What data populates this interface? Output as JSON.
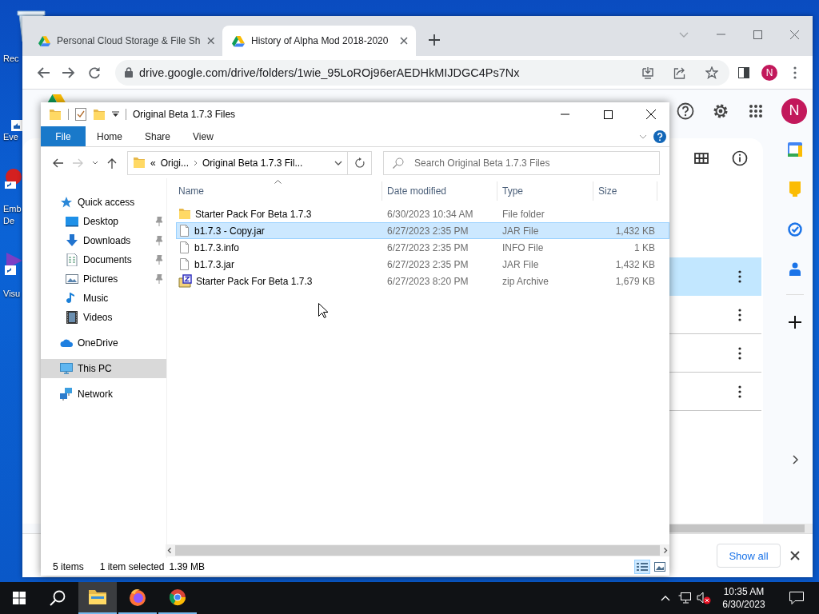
{
  "desktop": {
    "icons": [
      {
        "kind": "bin",
        "lines": [
          "Rec"
        ]
      },
      {
        "kind": "shortcut",
        "lines": [
          "Eve"
        ]
      },
      {
        "kind": "red-app",
        "lines": [
          "Emb",
          "De"
        ]
      },
      {
        "kind": "purple-app",
        "lines": [
          "Visu"
        ]
      }
    ]
  },
  "browser": {
    "tabs": [
      {
        "title": "Personal Cloud Storage & File Sh",
        "selected": false
      },
      {
        "title": "History of Alpha Mod 2018-2020",
        "selected": true
      }
    ],
    "url": "drive.google.com/drive/folders/1wie_95LoROj96erAEDHkMIJDGC4Ps7Nx",
    "profile_initial": "N",
    "drive": {
      "account_initial": "N",
      "rows": [
        {
          "selected": true
        },
        {
          "selected": false
        },
        {
          "selected": false
        },
        {
          "selected": false
        }
      ]
    },
    "downloads_bar": {
      "button": "Show all"
    }
  },
  "explorer": {
    "title": "Original Beta 1.7.3 Files",
    "ribbon": [
      {
        "label": "File",
        "kind": "file-menu"
      },
      {
        "label": "Home",
        "kind": "tab"
      },
      {
        "label": "Share",
        "kind": "tab"
      },
      {
        "label": "View",
        "kind": "tab"
      }
    ],
    "address": {
      "overflow": "«",
      "parts": [
        "Origi...",
        "Original Beta 1.7.3 Fil..."
      ]
    },
    "search": {
      "placeholder": "Search Original Beta 1.7.3 Files"
    },
    "nav": [
      {
        "label": "Quick access",
        "kind": "star",
        "selected": false,
        "children": [
          {
            "label": "Desktop",
            "kind": "desktop",
            "pinned": true,
            "selected": false
          },
          {
            "label": "Downloads",
            "kind": "downloads",
            "pinned": true,
            "selected": false
          },
          {
            "label": "Documents",
            "kind": "documents",
            "pinned": true,
            "selected": false
          },
          {
            "label": "Pictures",
            "kind": "pictures",
            "pinned": true,
            "selected": false
          },
          {
            "label": "Music",
            "kind": "music",
            "pinned": false,
            "selected": false
          },
          {
            "label": "Videos",
            "kind": "videos",
            "pinned": false,
            "selected": false
          }
        ]
      },
      {
        "label": "OneDrive",
        "kind": "cloud",
        "selected": false
      },
      {
        "label": "This PC",
        "kind": "pc",
        "selected": true
      },
      {
        "label": "Network",
        "kind": "network",
        "selected": false
      }
    ],
    "columns": [
      {
        "label": "Name",
        "sorted": true
      },
      {
        "label": "Date modified",
        "sorted": false
      },
      {
        "label": "Type",
        "sorted": false
      },
      {
        "label": "Size",
        "sorted": false
      }
    ],
    "files": [
      {
        "name": "Starter Pack For Beta 1.7.3",
        "date": "6/30/2023 10:34 AM",
        "type": "File folder",
        "kind": "folder",
        "selected": false
      },
      {
        "name": "b1.7.3 - Copy.jar",
        "date": "6/27/2023 2:35 PM",
        "type": "JAR File",
        "size": "1,432 KB",
        "kind": "file",
        "selected": true
      },
      {
        "name": "b1.7.3.info",
        "date": "6/27/2023 2:35 PM",
        "type": "INFO File",
        "size": "1 KB",
        "kind": "file",
        "selected": false
      },
      {
        "name": "b1.7.3.jar",
        "date": "6/27/2023 2:35 PM",
        "type": "JAR File",
        "size": "1,432 KB",
        "kind": "file",
        "selected": false
      },
      {
        "name": "Starter Pack For Beta 1.7.3",
        "date": "6/27/2023 8:20 PM",
        "type": "zip Archive",
        "size": "1,679 KB",
        "kind": "zip",
        "selected": false
      }
    ],
    "status": {
      "count": "5 items",
      "selection": "1 item selected",
      "size": "1.39 MB"
    },
    "views": [
      {
        "kind": "details",
        "selected": true
      },
      {
        "kind": "large-icons",
        "selected": false
      }
    ]
  },
  "taskbar": {
    "apps": [
      {
        "kind": "explorer",
        "selected": true
      },
      {
        "kind": "firefox",
        "selected": false
      },
      {
        "kind": "chrome",
        "selected": false
      }
    ],
    "time": "10:35 AM",
    "date": "6/30/2023"
  }
}
